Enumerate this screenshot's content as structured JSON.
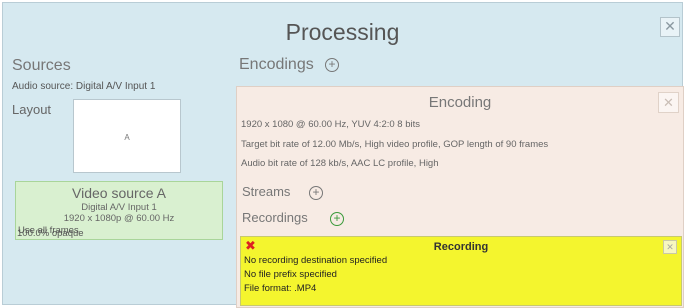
{
  "window": {
    "title": "Processing",
    "close_icon": "close-icon"
  },
  "sources": {
    "heading": "Sources",
    "audio_source": "Audio source: Digital A/V Input 1",
    "layout_label": "Layout",
    "layout_cell": "A",
    "video_card": {
      "title": "Video source A",
      "input": "Digital A/V Input 1",
      "resolution": "1920 x 1080p @ 60.00 Hz",
      "frames": "Use all frames",
      "opacity": "100.0% opaque"
    }
  },
  "encodings": {
    "heading": "Encodings",
    "add_icon": "plus-circle-icon",
    "panel": {
      "title": "Encoding",
      "line1": "1920  x  1080  @ 60.00 Hz,  YUV 4:2:0 8 bits",
      "line2": "Target bit rate of  12.00  Mb/s,  High video profile, GOP length of 90  frames",
      "line3": "Audio bit rate of 128 kb/s,  AAC LC profile, High",
      "streams_label": "Streams",
      "recordings_label": "Recordings",
      "recording": {
        "title": "Recording",
        "error_icon": "error-x-icon",
        "line1": "No recording destination specified",
        "line2": "No file prefix specified",
        "line3": "File format: .MP4"
      }
    }
  },
  "colors": {
    "background": "#d6e9f0",
    "video_card": "#d9f0d0",
    "encoding_panel": "#f7ebe4",
    "recording_panel": "#f4f52e",
    "add_recording_icon": "#3a9a3a"
  }
}
